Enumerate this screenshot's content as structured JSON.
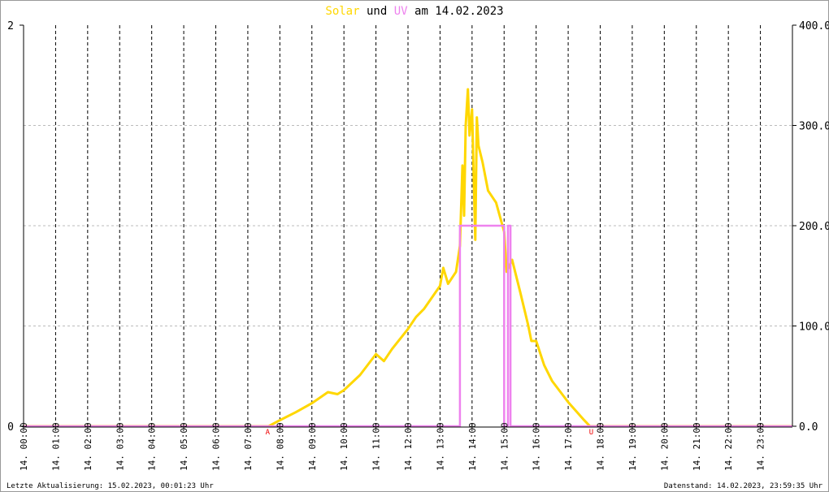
{
  "chart_data": {
    "type": "line",
    "title": {
      "part1": "Solar",
      "part2": "und",
      "part3": "UV",
      "part4": "am 14.02.2023"
    },
    "date_prefix": "14.",
    "x_ticks": [
      "00:00",
      "01:00",
      "02:00",
      "03:00",
      "04:00",
      "05:00",
      "06:00",
      "07:00",
      "08:00",
      "09:00",
      "10:00",
      "11:00",
      "12:00",
      "13:00",
      "14:00",
      "15:00",
      "16:00",
      "17:00",
      "18:00",
      "19:00",
      "20:00",
      "21:00",
      "22:00",
      "23:00"
    ],
    "xlim_hours": [
      0,
      24
    ],
    "y_left": {
      "label": "UV",
      "ylim": [
        0,
        2
      ],
      "ticks": [
        "0",
        "2"
      ]
    },
    "y_right": {
      "label": "Solar",
      "ylim": [
        0,
        400
      ],
      "ticks": [
        "0.0",
        "100.0",
        "200.0",
        "300.0",
        "400.0"
      ]
    },
    "grid": true,
    "markers": [
      {
        "label": "A",
        "hour": 7.62
      },
      {
        "label": "U",
        "hour": 17.72
      }
    ],
    "series": [
      {
        "name": "Solar",
        "axis": "right",
        "color": "#ffd700",
        "x": [
          0,
          7.65,
          8.0,
          8.5,
          9.0,
          9.5,
          9.8,
          10.0,
          10.5,
          11.0,
          11.25,
          11.5,
          12.0,
          12.25,
          12.5,
          13.0,
          13.1,
          13.25,
          13.5,
          13.62,
          13.7,
          13.75,
          13.8,
          13.87,
          13.92,
          14.0,
          14.05,
          14.1,
          14.15,
          14.2,
          14.33,
          14.5,
          14.75,
          15.0,
          15.08,
          15.25,
          15.5,
          15.75,
          15.85,
          16.0,
          16.25,
          16.5,
          17.0,
          17.5,
          17.68,
          24
        ],
        "y": [
          0,
          0,
          6,
          14,
          23,
          34,
          32,
          36,
          51,
          72,
          65,
          77,
          97,
          109,
          117,
          140,
          158,
          142,
          154,
          180,
          260,
          210,
          300,
          336,
          290,
          316,
          250,
          186,
          308,
          280,
          263,
          235,
          223,
          194,
          154,
          166,
          134,
          101,
          85,
          85,
          61,
          45,
          24,
          6,
          0,
          0
        ]
      },
      {
        "name": "UV",
        "axis": "left",
        "color": "#ee82ee",
        "x": [
          0,
          13.62,
          13.62,
          15.0,
          15.0,
          15.12,
          15.12,
          15.2,
          15.2,
          24
        ],
        "y": [
          0,
          0,
          1,
          1,
          0,
          0,
          1,
          1,
          0,
          0
        ]
      }
    ]
  },
  "footer": {
    "last_update": "Letzte Aktualisierung: 15.02.2023, 00:01:23 Uhr",
    "data_state": "Datenstand: 14.02.2023, 23:59:35 Uhr"
  }
}
